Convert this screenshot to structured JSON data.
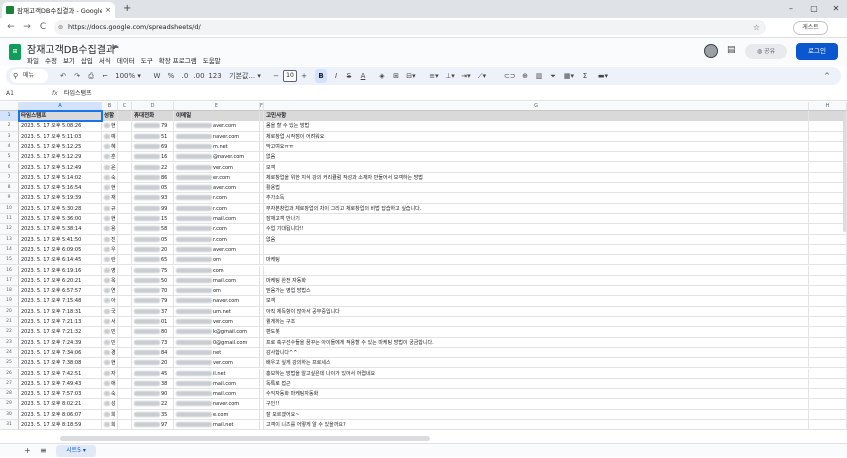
{
  "browser": {
    "tab_title": "잠재고객DB수집결과 - Google",
    "url": "https://docs.google.com/spreadsheets/d/",
    "guest_label": "게스트",
    "new_tab": "+",
    "tab_close": "×",
    "back": "←",
    "forward": "→",
    "reload": "C",
    "lock": "⊜",
    "star": "☆",
    "minimize": "–",
    "maximize": "▢",
    "close": "✕"
  },
  "doc": {
    "title": "잠재고객DB수집결과",
    "menu": [
      "파일",
      "수정",
      "보기",
      "삽입",
      "서식",
      "데이터",
      "도구",
      "확장 프로그램",
      "도움말"
    ],
    "share_label": "공유",
    "login_label": "로그인"
  },
  "toolbar": {
    "search_label": "메뉴",
    "zoom": "100%",
    "font": "기본값...",
    "font_size": "10",
    "bold": "B",
    "italic": "I",
    "strike": "S",
    "text_color": "A",
    "percent": "%",
    "won": "W",
    "currency_icons": [
      ".0",
      ".00",
      "123"
    ]
  },
  "formula_bar": {
    "name_box": "A1",
    "fx": "fx",
    "value": "타임스탬프"
  },
  "grid": {
    "col_letters": [
      "A",
      "B",
      "C",
      "D",
      "E",
      "F",
      "G",
      "H"
    ],
    "headers": [
      "타임스탬프",
      "성함",
      "휴대전화",
      "이메일",
      "고민사항"
    ],
    "row_numbers": [
      "1",
      "2",
      "3",
      "4",
      "5",
      "6",
      "7",
      "8",
      "9",
      "10",
      "11",
      "12",
      "13",
      "14",
      "15",
      "16",
      "17",
      "18",
      "19",
      "20",
      "21",
      "22",
      "23",
      "24",
      "25",
      "26",
      "27",
      "28",
      "29",
      "30",
      "31"
    ],
    "rows": [
      {
        "ts": "2023. 5. 17 오후 5:08:26",
        "name": "현",
        "phone": "79",
        "email": "aver.com",
        "memo": "몸을 할 수 있는 방법"
      },
      {
        "ts": "2023. 5. 17 오후 5:11:03",
        "name": "예",
        "phone": "51",
        "email": "naver.com",
        "memo": "체로창업 시작점이 어려워요"
      },
      {
        "ts": "2023. 5. 17 오후 5:12:25",
        "name": "혜",
        "phone": "69",
        "email": "m.net",
        "memo": "막고여요ㅠㅠ"
      },
      {
        "ts": "2023. 5. 17 오후 5:12:29",
        "name": "훈",
        "phone": "16",
        "email": "@naver.com",
        "memo": "없음"
      },
      {
        "ts": "2023. 5. 17 오후 5:12:49",
        "name": "윤",
        "phone": "22",
        "email": "ver.com",
        "memo": "모객"
      },
      {
        "ts": "2023. 5. 17 오후 5:14:02",
        "name": "숙",
        "phone": "86",
        "email": "er.com",
        "memo": "체로창업을 위한 지식 강의 커리큘럼 작성과 소재자 만들어서 모객하는 방법"
      },
      {
        "ts": "2023. 5. 17 오후 5:16:54",
        "name": "현",
        "phone": "05",
        "email": "aver.com",
        "memo": "활용법"
      },
      {
        "ts": "2023. 5. 17 오후 5:19:39",
        "name": "재",
        "phone": "93",
        "email": "r.com",
        "memo": "추가소득"
      },
      {
        "ts": "2023. 5. 17 오후 5:30:28",
        "name": "규",
        "phone": "99",
        "email": "r.com",
        "memo": "무자본창업과 체로창업의 차이 그리고 체로창업의 비법 답습하고 싶습니다."
      },
      {
        "ts": "2023. 5. 17 오후 5:36:00",
        "name": "현",
        "phone": "15",
        "email": "mail.com",
        "memo": "잠재고객 만나기"
      },
      {
        "ts": "2023. 5. 17 오후 5:38:14",
        "name": "용",
        "phone": "58",
        "email": "r.com",
        "memo": "수업 기대됩니다!!"
      },
      {
        "ts": "2023. 5. 17 오후 5:41:50",
        "name": "진",
        "phone": "05",
        "email": "r.com",
        "memo": "없음"
      },
      {
        "ts": "2023. 5. 17 오후 6:09:05",
        "name": "우",
        "phone": "20",
        "email": "aver.com",
        "memo": ""
      },
      {
        "ts": "2023. 5. 17 오후 6:14:45",
        "name": "란",
        "phone": "65",
        "email": "om",
        "memo": "마케팅"
      },
      {
        "ts": "2023. 5. 17 오후 6:19:16",
        "name": "영",
        "phone": "75",
        "email": "com",
        "memo": ""
      },
      {
        "ts": "2023. 5. 17 오후 6:20:21",
        "name": "옥",
        "phone": "50",
        "email": "mail.com",
        "memo": "마케팅 완전 자동화"
      },
      {
        "ts": "2023. 5. 17 오후 6:57:57",
        "name": "연",
        "phone": "70",
        "email": "om",
        "memo": "믿음가는 영업 방법스"
      },
      {
        "ts": "2023. 5. 17 오후 7:15:48",
        "name": "아",
        "phone": "79",
        "email": "naver.com",
        "memo": "모객"
      },
      {
        "ts": "2023. 5. 17 오후 7:18:31",
        "name": "국",
        "phone": "37",
        "email": "um.net",
        "memo": "아직 체득항이 많아서 공부중입니다"
      },
      {
        "ts": "2023. 5. 17 오후 7:21:13",
        "name": "서",
        "phone": "01",
        "email": "ver.com",
        "memo": "퀼게하는 구조"
      },
      {
        "ts": "2023. 5. 17 오후 7:21:32",
        "name": "민",
        "phone": "80",
        "email": "k@gmail.com",
        "memo": "판도봇"
      },
      {
        "ts": "2023. 5. 17 오후 7:24:39",
        "name": "민",
        "phone": "73",
        "email": "0@gmail.com",
        "memo": "프로 축구선수들을 꿈꾸는 아이들에게 적용할 수 있는 마케팅 방법이 궁금합니다."
      },
      {
        "ts": "2023. 5. 17 오후 7:34:06",
        "name": "경",
        "phone": "84",
        "email": "net",
        "memo": "감사합니다^^"
      },
      {
        "ts": "2023. 5. 17 오후 7:38:08",
        "name": "현",
        "phone": "20",
        "email": "ver.com",
        "memo": "배우고 싶게 강의하는 프로세스"
      },
      {
        "ts": "2023. 5. 17 오후 7:42:51",
        "name": "자",
        "phone": "45",
        "email": "il.net",
        "memo": "홍보하는 방법을 알고싶은데 나이가 있어서 어렵네요"
      },
      {
        "ts": "2023. 5. 17 오후 7:49:43",
        "name": "애",
        "phone": "38",
        "email": "mail.com",
        "memo": "독특로 접근"
      },
      {
        "ts": "2023. 5. 17 오후 7:57:03",
        "name": "숙",
        "phone": "90",
        "email": "mail.com",
        "memo": "수익자동화 마케팅자동화"
      },
      {
        "ts": "2023. 5. 17 오후 8:02:21",
        "name": "성",
        "phone": "22",
        "email": "naver.com",
        "memo": "구인!!"
      },
      {
        "ts": "2023. 5. 17 오후 8:06:07",
        "name": "희",
        "phone": "35",
        "email": "e.com",
        "memo": "잘 모르겠어요~"
      },
      {
        "ts": "2023. 5. 17 오후 8:18:59",
        "name": "희",
        "phone": "97",
        "email": "mail.net",
        "memo": "고객이 니즈를 어떻게 알 수 있을까요?"
      }
    ]
  },
  "sheets": {
    "add": "+",
    "all": "≡",
    "active_tab": "시트5"
  }
}
